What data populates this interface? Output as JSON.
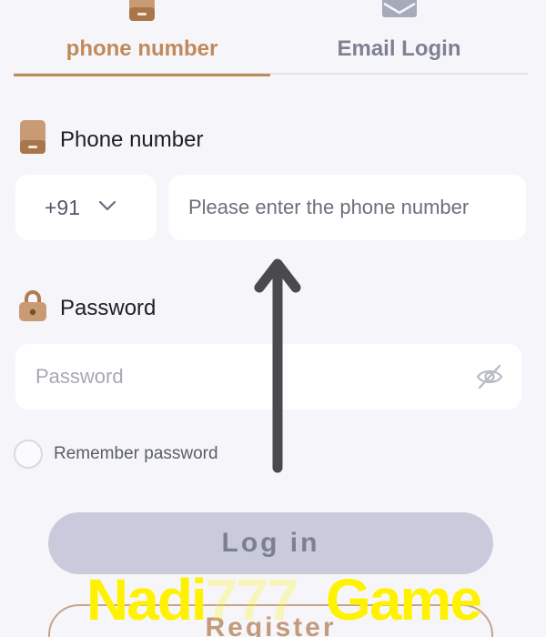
{
  "tabs": {
    "phone_label": "phone number",
    "email_label": "Email Login",
    "active": "phone"
  },
  "phone_section": {
    "label": "Phone number",
    "country_code": "+91",
    "placeholder": "Please enter the phone number"
  },
  "password_section": {
    "label": "Password",
    "placeholder": "Password"
  },
  "remember": {
    "label": "Remember password",
    "checked": false
  },
  "buttons": {
    "login": "Log in",
    "register": "Register"
  },
  "watermark": {
    "prefix": "Nadi",
    "digits": "777",
    "suffix": "Game"
  },
  "icons": {
    "phone_tab": "phone-icon",
    "email_tab": "envelope-icon",
    "phone_section": "phone-icon",
    "password_section": "lock-icon",
    "country_dropdown": "chevron-down-icon",
    "password_toggle": "eye-off-icon",
    "overlay": "arrow-up-icon"
  },
  "colors": {
    "accent": "#c08a5b",
    "login_button_bg": "#c9cbdc",
    "background": "#f6f6fa",
    "watermark": "#fff200"
  }
}
